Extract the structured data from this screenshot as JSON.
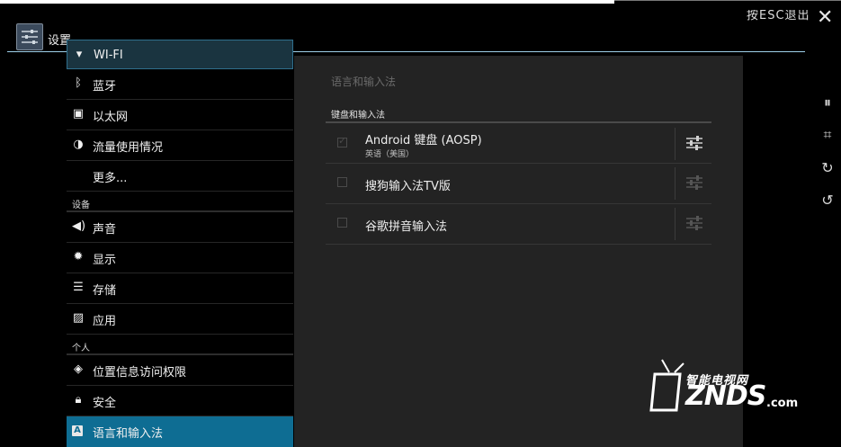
{
  "header": {
    "title": "设置",
    "esc_hint": "按ESC退出"
  },
  "sidebar": {
    "items": [
      {
        "label": "WI-FI",
        "icon": "wifi-icon"
      },
      {
        "label": "蓝牙",
        "icon": "bluetooth-icon"
      },
      {
        "label": "以太网",
        "icon": "ethernet-icon"
      },
      {
        "label": "流量使用情况",
        "icon": "data-usage-icon"
      },
      {
        "label": "更多...",
        "icon": ""
      },
      {
        "label": "声音",
        "icon": "sound-icon"
      },
      {
        "label": "显示",
        "icon": "display-icon"
      },
      {
        "label": "存储",
        "icon": "storage-icon"
      },
      {
        "label": "应用",
        "icon": "apps-icon"
      },
      {
        "label": "位置信息访问权限",
        "icon": "location-icon"
      },
      {
        "label": "安全",
        "icon": "lock-icon"
      },
      {
        "label": "语言和输入法",
        "icon": "language-icon"
      }
    ],
    "sections": {
      "device": "设备",
      "personal": "个人"
    },
    "selected_index": 11
  },
  "panel": {
    "title": "语言和输入法",
    "category": "键盘和输入法",
    "methods": [
      {
        "name": "Android 键盘 (AOSP)",
        "sub": "英语（美国）",
        "checked": true
      },
      {
        "name": "搜狗输入法TV版",
        "sub": "",
        "checked": false
      },
      {
        "name": "谷歌拼音输入法",
        "sub": "",
        "checked": false
      }
    ]
  },
  "overlay_controls": [
    "pause-icon",
    "crop-icon",
    "rotate-right-icon",
    "rotate-left-icon"
  ],
  "watermark": {
    "top": "智能电视网",
    "brand": "ZNDS",
    "suffix": ".com"
  },
  "colors": {
    "accent": "#0e6d93",
    "panel_bg": "#232323",
    "actionbar_line": "#9ed0ea"
  }
}
